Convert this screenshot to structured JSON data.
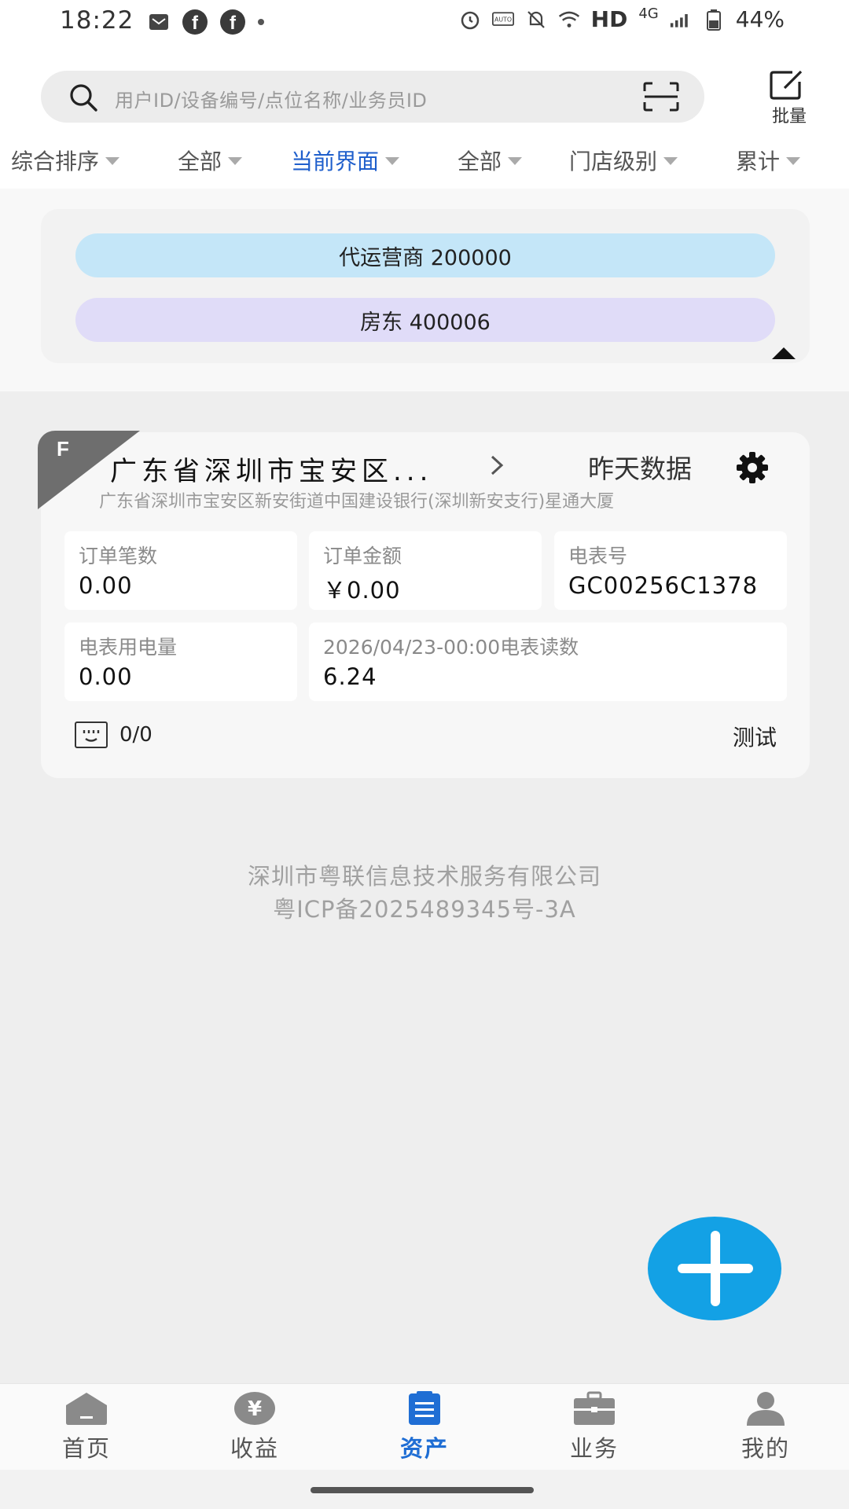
{
  "status_bar": {
    "time": "18:22",
    "network": "HD",
    "signal_type": "4G",
    "battery": "44%",
    "icons": [
      "mail-icon",
      "facebook-icon",
      "facebook-icon",
      "dot-icon",
      "alarm-icon",
      "auto-hz-icon",
      "mute-icon",
      "wifi-icon",
      "signal-icon",
      "battery-icon"
    ]
  },
  "search": {
    "placeholder": "用户ID/设备编号/点位名称/业务员ID",
    "icon": "search-icon",
    "scan_icon": "scan-icon"
  },
  "batch": {
    "label": "批量",
    "icon": "edit-icon"
  },
  "filters": [
    {
      "label": "综合排序"
    },
    {
      "label": "全部"
    },
    {
      "label": "当前界面"
    },
    {
      "label": "全部"
    },
    {
      "label": "门店级别"
    },
    {
      "label": "累计"
    }
  ],
  "active_filter": "当前界面",
  "roles": [
    {
      "label": "代运营商 200000",
      "color": "#c4e6f8"
    },
    {
      "label": "房东 400006",
      "color": "#e0dcf8"
    }
  ],
  "card": {
    "badge": "F",
    "title": "广东省深圳市宝安区...",
    "data_label": "昨天数据",
    "address": "广东省深圳市宝安区新安街道中国建设银行(深圳新安支行)星通大厦",
    "cells": [
      {
        "label": "订单笔数",
        "value": "0.00"
      },
      {
        "label": "订单金额",
        "value": "￥0.00"
      },
      {
        "label": "电表号",
        "value": "GC00256C1378"
      },
      {
        "label": "电表用电量",
        "value": "0.00"
      },
      {
        "label": "2026/04/23-00:00电表读数",
        "value": "6.24"
      }
    ],
    "meter_count": "0/0",
    "tag": "测试"
  },
  "company": {
    "name": "深圳市粤联信息技术服务有限公司",
    "icp": "粤ICP备2025489345号-3A"
  },
  "nav": [
    {
      "label": "首页",
      "icon": "home-icon"
    },
    {
      "label": "收益",
      "icon": "yen-icon"
    },
    {
      "label": "资产",
      "icon": "clipboard-icon"
    },
    {
      "label": "业务",
      "icon": "briefcase-icon"
    },
    {
      "label": "我的",
      "icon": "user-icon"
    }
  ],
  "active_nav": "资产",
  "colors": {
    "accent": "#1f6ed4",
    "fab": "#13a1e5"
  }
}
